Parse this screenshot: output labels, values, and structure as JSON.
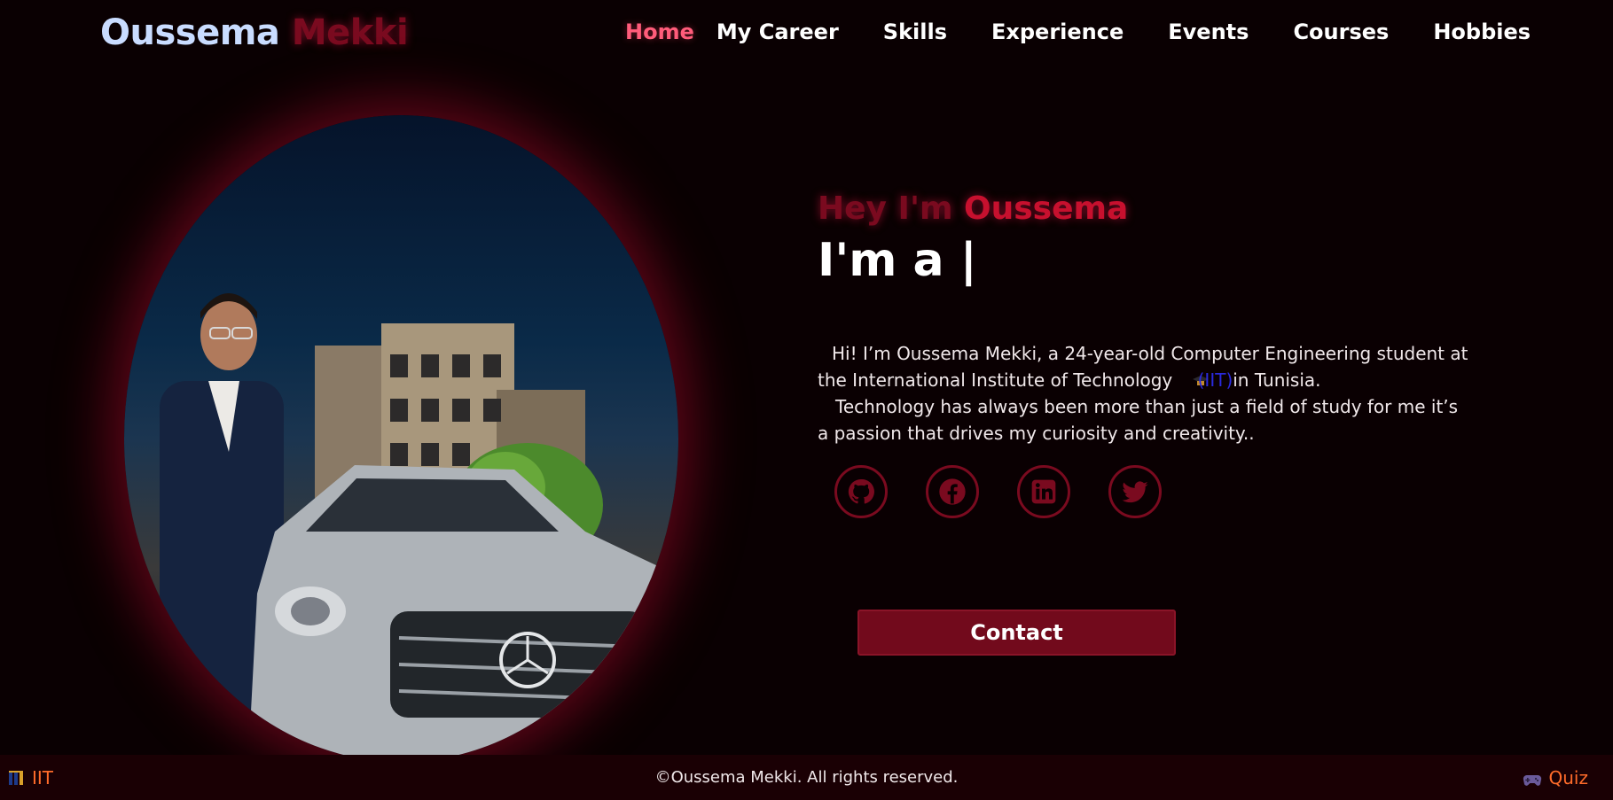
{
  "header": {
    "logo_first": "Oussema",
    "logo_last": "Mekki",
    "nav": [
      {
        "label": "Home",
        "active": true
      },
      {
        "label": "My Career"
      },
      {
        "label": "Skills"
      },
      {
        "label": "Experience"
      },
      {
        "label": "Events"
      },
      {
        "label": "Courses"
      },
      {
        "label": "Hobbies"
      }
    ]
  },
  "hero": {
    "greeting_prefix": "Hey I'm ",
    "greeting_name": "Oussema",
    "role_prefix": "I'm a |",
    "bio_line1": "Hi! I’m Oussema Mekki, a 24-year-old Computer Engineering student at the International Institute of Technology ",
    "bio_iit_icon": "graduation-cap-icon",
    "bio_iit": "(IIT)",
    "bio_line1_end": "in Tunisia.",
    "bio_line2": "Technology has always been more than just a field of study for me it’s a passion that drives my curiosity and creativity..",
    "socials": [
      "github-icon",
      "facebook-icon",
      "linkedin-icon",
      "twitter-icon"
    ],
    "contact_label": "Contact"
  },
  "footer": {
    "left_label": "IIT",
    "left_icon": "iit-logo-icon",
    "center": "©Oussema Mekki. All rights reserved.",
    "right_icon": "gamepad-icon",
    "right_label": "Quiz"
  },
  "colors": {
    "background": "#0a0002",
    "accent": "#7a0a1f",
    "active_nav": "#ff5c7a",
    "logo_first": "#c9dcff",
    "footer_link": "#ff6b2a",
    "button": "#720a1c"
  }
}
